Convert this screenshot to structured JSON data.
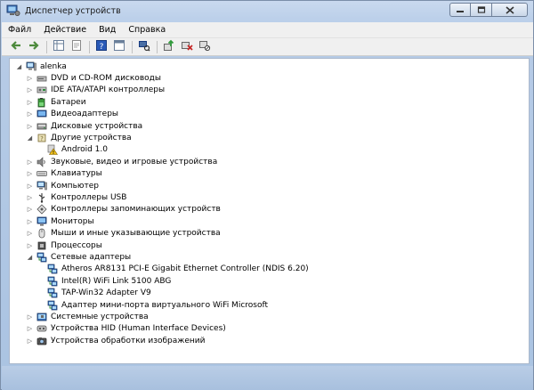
{
  "window": {
    "title": "Диспетчер устройств"
  },
  "menu": [
    "Файл",
    "Действие",
    "Вид",
    "Справка"
  ],
  "toolbar": [
    {
      "icon": "back-arrow-icon",
      "color": "#4d8a3c"
    },
    {
      "icon": "forward-arrow-icon",
      "color": "#4d8a3c"
    },
    {
      "sep": true
    },
    {
      "icon": "properties-grid-icon",
      "color": "#6a7f9a"
    },
    {
      "icon": "document-icon",
      "color": "#8a8a8a"
    },
    {
      "sep": true
    },
    {
      "icon": "help-icon",
      "color": "#2a5ab8"
    },
    {
      "icon": "console-icon",
      "color": "#6a7f9a"
    },
    {
      "sep": true
    },
    {
      "icon": "scan-hardware-icon",
      "color": "#4a6fa5"
    },
    {
      "sep": true
    },
    {
      "icon": "update-driver-icon",
      "color": "#2f9a3a"
    },
    {
      "icon": "uninstall-icon",
      "color": "#c62828"
    },
    {
      "icon": "disable-device-icon",
      "color": "#6a7f9a"
    }
  ],
  "tree": [
    {
      "level": 0,
      "exp": "open",
      "icon": "computer-icon",
      "label": "alenka"
    },
    {
      "level": 1,
      "exp": "closed",
      "icon": "dvd-drive-icon",
      "label": "DVD и CD-ROM дисководы"
    },
    {
      "level": 1,
      "exp": "closed",
      "icon": "ide-controller-icon",
      "label": "IDE ATA/ATAPI контроллеры"
    },
    {
      "level": 1,
      "exp": "closed",
      "icon": "battery-icon",
      "label": "Батареи"
    },
    {
      "level": 1,
      "exp": "closed",
      "icon": "display-adapter-icon",
      "label": "Видеоадаптеры"
    },
    {
      "level": 1,
      "exp": "closed",
      "icon": "disk-drive-icon",
      "label": "Дисковые устройства"
    },
    {
      "level": 1,
      "exp": "open",
      "icon": "other-devices-icon",
      "label": "Другие устройства"
    },
    {
      "level": 2,
      "exp": "none",
      "icon": "warning-device-icon",
      "label": "Android 1.0"
    },
    {
      "level": 1,
      "exp": "closed",
      "icon": "sound-icon",
      "label": "Звуковые, видео и игровые устройства"
    },
    {
      "level": 1,
      "exp": "closed",
      "icon": "keyboard-icon",
      "label": "Клавиатуры"
    },
    {
      "level": 1,
      "exp": "closed",
      "icon": "computer-icon",
      "label": "Компьютер"
    },
    {
      "level": 1,
      "exp": "closed",
      "icon": "usb-icon",
      "label": "Контроллеры USB"
    },
    {
      "level": 1,
      "exp": "closed",
      "icon": "storage-controller-icon",
      "label": "Контроллеры запоминающих устройств"
    },
    {
      "level": 1,
      "exp": "closed",
      "icon": "monitor-icon",
      "label": "Мониторы"
    },
    {
      "level": 1,
      "exp": "closed",
      "icon": "mouse-icon",
      "label": "Мыши и иные указывающие устройства"
    },
    {
      "level": 1,
      "exp": "closed",
      "icon": "processor-icon",
      "label": "Процессоры"
    },
    {
      "level": 1,
      "exp": "open",
      "icon": "network-adapter-icon",
      "label": "Сетевые адаптеры"
    },
    {
      "level": 2,
      "exp": "none",
      "icon": "network-adapter-icon",
      "label": "Atheros AR8131 PCI-E Gigabit Ethernet Controller (NDIS 6.20)"
    },
    {
      "level": 2,
      "exp": "none",
      "icon": "network-adapter-icon",
      "label": "Intel(R) WiFi Link 5100 ABG"
    },
    {
      "level": 2,
      "exp": "none",
      "icon": "network-adapter-icon",
      "label": "TAP-Win32 Adapter V9"
    },
    {
      "level": 2,
      "exp": "none",
      "icon": "network-adapter-icon",
      "label": "Адаптер мини-порта виртуального WiFi Microsoft"
    },
    {
      "level": 1,
      "exp": "closed",
      "icon": "system-devices-icon",
      "label": "Системные устройства"
    },
    {
      "level": 1,
      "exp": "closed",
      "icon": "hid-icon",
      "label": "Устройства HID (Human Interface Devices)"
    },
    {
      "level": 1,
      "exp": "closed",
      "icon": "imaging-device-icon",
      "label": "Устройства обработки изображений"
    }
  ]
}
